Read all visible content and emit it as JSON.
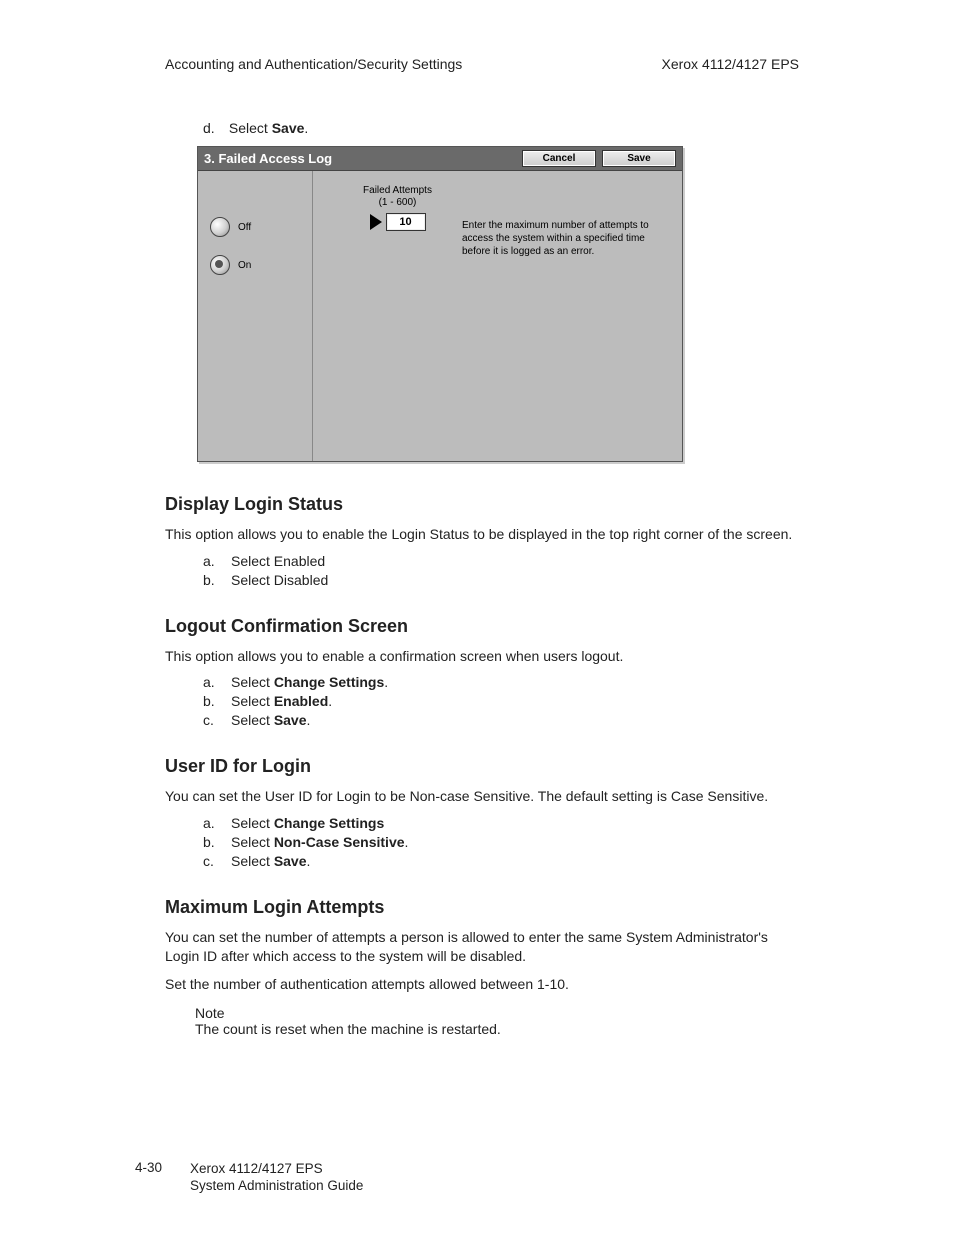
{
  "header": {
    "left": "Accounting and Authentication/Security Settings",
    "right": "Xerox 4112/4127 EPS"
  },
  "top_step": {
    "letter": "d.",
    "pre": "Select ",
    "bold": "Save",
    "post": "."
  },
  "ui": {
    "title": "3. Failed Access Log",
    "cancel": "Cancel",
    "save": "Save",
    "off_label": "Off",
    "on_label": "On",
    "attempts_header": "Failed Attempts",
    "attempts_range": "(1 - 600)",
    "attempts_value": "10",
    "help_text": "Enter the maximum number of attempts to access the system within a specified time before it is logged as an error."
  },
  "s1": {
    "heading": "Display Login Status",
    "desc": "This option allows you to enable the Login Status to be displayed in the top right corner of the screen.",
    "a": "Select Enabled",
    "b": "Select Disabled"
  },
  "s2": {
    "heading": "Logout Confirmation Screen",
    "desc": "This option allows you to enable a confirmation screen when users logout.",
    "a_pre": "Select ",
    "a_bold": "Change Settings",
    "a_post": ".",
    "b_pre": "Select ",
    "b_bold": "Enabled",
    "b_post": ".",
    "c_pre": "Select ",
    "c_bold": "Save",
    "c_post": "."
  },
  "s3": {
    "heading": "User ID for Login",
    "desc": "You can set the User ID for Login to be Non-case Sensitive. The default setting is Case Sensitive.",
    "a_pre": "Select ",
    "a_bold": "Change Settings",
    "b_pre": "Select ",
    "b_bold": "Non-Case Sensitive",
    "b_post": ".",
    "c_pre": "Select ",
    "c_bold": "Save",
    "c_post": "."
  },
  "s4": {
    "heading": "Maximum Login Attempts",
    "p1": "You can set the number of attempts a person is allowed to enter the same System Administrator's Login ID after which access to the system will be disabled.",
    "p2": "Set the number of authentication attempts allowed between 1-10.",
    "note_label": "Note",
    "note_text": "The count is reset when the machine is restarted."
  },
  "footer": {
    "page": "4-30",
    "line1": "Xerox 4112/4127 EPS",
    "line2": "System Administration Guide"
  }
}
